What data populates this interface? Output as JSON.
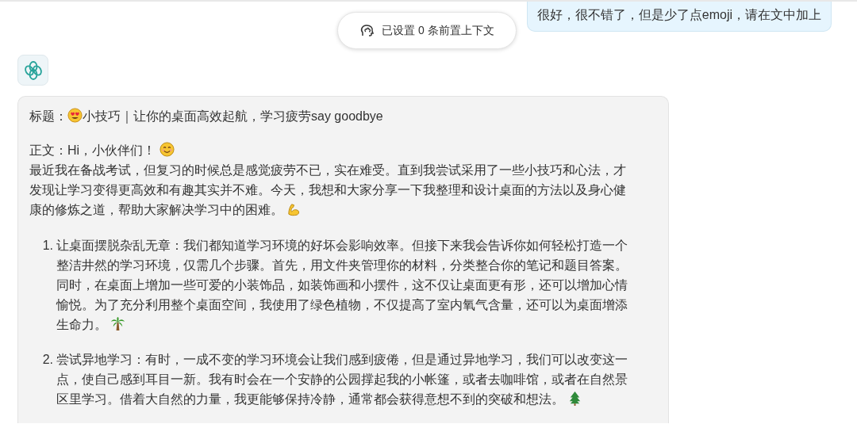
{
  "user_message": {
    "text": "很好，很不错了，但是少了点emoji，请在文中加上"
  },
  "context_pill": {
    "text": "已设置 0 条前置上下文"
  },
  "assistant_message": {
    "title_label": "标题：",
    "title": "小技巧｜让你的桌面高效起航，学习疲劳say goodbye",
    "greeting": "正文：Hi，小伙伴们！",
    "intro": [
      "最近我在备战考试，但复习的时候总是感觉疲劳不已，实在难受。直到我尝试采用了一些小技巧和心法，才",
      "发现让学习变得更高效和有趣其实并不难。今天，我想和大家分享一下我整理和设计桌面的方法以及身心健",
      "康的修炼之道，帮助大家解决学习中的困难。"
    ],
    "list": [
      {
        "number": "1.",
        "lines": [
          "让桌面摆脱杂乱无章：我们都知道学习环境的好坏会影响效率。但接下来我会告诉你如何轻松打造一个",
          "整洁井然的学习环境，仅需几个步骤。首先，用文件夹管理你的材料，分类整合你的笔记和题目答案。",
          "同时，在桌面上增加一些可爱的小装饰品，如装饰画和小摆件，这不仅让桌面更有形，还可以增加心情",
          "愉悦。为了充分利用整个桌面空间，我使用了绿色植物，不仅提高了室内氧气含量，还可以为桌面增添",
          "生命力。"
        ]
      },
      {
        "number": "2.",
        "lines": [
          "尝试异地学习：有时，一成不变的学习环境会让我们感到疲倦，但是通过异地学习，我们可以改变这一",
          "点，使自己感到耳目一新。我有时会在一个安静的公园撑起我的小帐篷，或者去咖啡馆，或者在自然景",
          "区里学习。借着大自然的力量，我更能够保持冷静，通常都会获得意想不到的突破和想法。"
        ]
      }
    ]
  }
}
